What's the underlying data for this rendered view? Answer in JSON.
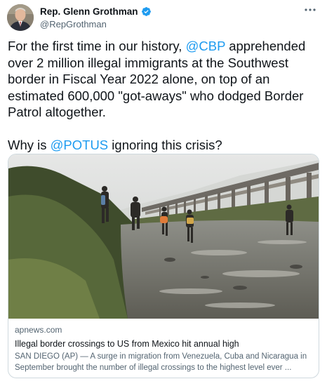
{
  "author": {
    "display_name": "Rep. Glenn Grothman",
    "handle": "@RepGrothman",
    "verified": true,
    "avatar_icon": "profile-photo"
  },
  "tweet": {
    "paragraph1": [
      {
        "text": "For the first time in our history, ",
        "type": "text"
      },
      {
        "text": "@CBP",
        "type": "mention"
      },
      {
        "text": " apprehended over 2 million illegal immigrants at the Southwest border in Fiscal Year 2022 alone, on top of an estimated 600,000 \"got-aways\" who dodged Border Patrol altogether.",
        "type": "text"
      }
    ],
    "paragraph2": [
      {
        "text": "Why is ",
        "type": "text"
      },
      {
        "text": "@POTUS",
        "type": "mention"
      },
      {
        "text": " ignoring this crisis?",
        "type": "text"
      }
    ]
  },
  "card": {
    "domain": "apnews.com",
    "title": "Illegal border crossings to US from Mexico hit annual high",
    "description": "SAN DIEGO (AP) — A surge in migration from Venezuela, Cuba and Nicaragua in September brought the number of illegal crossings to the highest level ever ..."
  },
  "icons": {
    "verified": "verified-badge-icon",
    "more": "more-options-icon"
  },
  "colors": {
    "link": "#1d9bf0",
    "text": "#0f1419",
    "secondary": "#536471",
    "border": "#cfd9de"
  }
}
